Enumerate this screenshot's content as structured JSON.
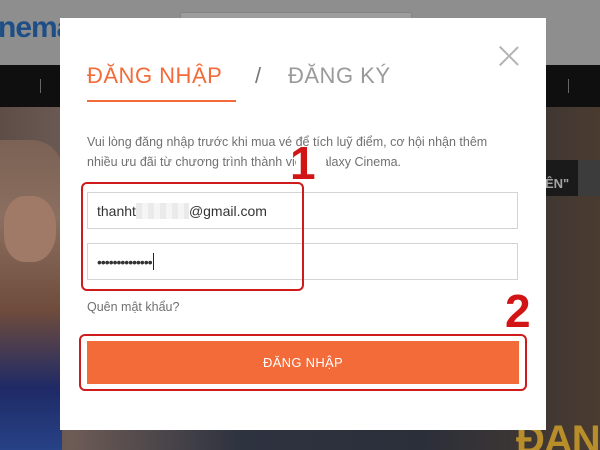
{
  "background": {
    "logo_text": "nema",
    "hero_right_label": "ÊN\"",
    "hero_promo_text": "ĐAN"
  },
  "modal": {
    "tabs": {
      "login": "ĐĂNG NHẬP",
      "separator": "/",
      "register": "ĐĂNG KÝ"
    },
    "intro_line1": "Vui lòng đăng nhập trước khi mua vé để tích luỹ điểm, cơ hội nhận thêm",
    "intro_line2": "nhiều ưu đãi từ chương trình thành viên Galaxy Cinema.",
    "email": {
      "value_prefix": "thanht",
      "value_suffix": "@gmail.com"
    },
    "password": {
      "masked_value": "••••••••••••••"
    },
    "forgot_password": "Quên mật khẩu?",
    "submit_label": "ĐĂNG NHẬP"
  },
  "annotations": {
    "step1": "1",
    "step2": "2",
    "color": "#cf1b1b"
  },
  "colors": {
    "accent": "#f26b38",
    "overlay": "#000000"
  },
  "icons": {
    "close": "close-icon"
  }
}
